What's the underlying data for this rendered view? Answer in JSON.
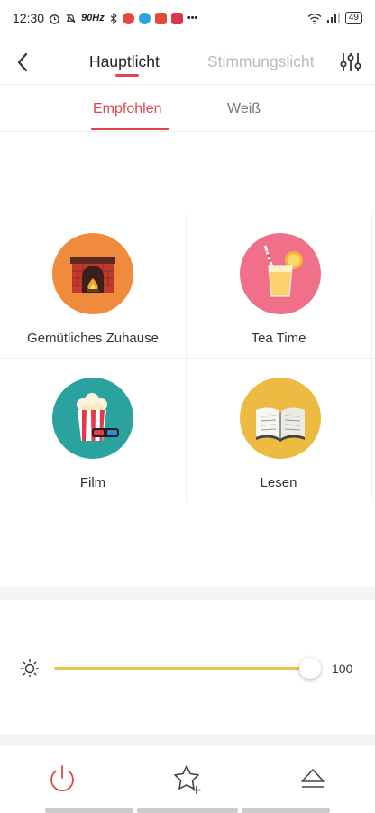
{
  "status_bar": {
    "time": "12:30",
    "refresh_rate": "90Hz",
    "battery": "49",
    "app_icon_colors": [
      "#e8473c",
      "#2aa3e0",
      "#e34b35",
      "#d9384c"
    ]
  },
  "header": {
    "tabs": [
      {
        "label": "Hauptlicht",
        "active": true
      },
      {
        "label": "Stimmungslicht",
        "active": false
      }
    ],
    "accent_color": "#e0474c"
  },
  "subtabs": [
    {
      "label": "Empfohlen",
      "active": true
    },
    {
      "label": "Weiß",
      "active": false
    }
  ],
  "scenes": [
    {
      "label": "Gemütliches Zuhause",
      "icon": "fireplace-icon",
      "color": "#f08a3c"
    },
    {
      "label": "Tea Time",
      "icon": "drink-icon",
      "color": "#f0708a"
    },
    {
      "label": "Film",
      "icon": "popcorn-icon",
      "color": "#2aa39f"
    },
    {
      "label": "Lesen",
      "icon": "book-icon",
      "color": "#edbb42"
    }
  ],
  "brightness": {
    "value": "100",
    "level_percent": 100,
    "track_color": "#f0c34e"
  },
  "bottom_bar": {
    "power_icon": "power-icon",
    "favorite_icon": "star-plus-icon",
    "eject_icon": "eject-icon",
    "power_color": "#e0474c"
  }
}
